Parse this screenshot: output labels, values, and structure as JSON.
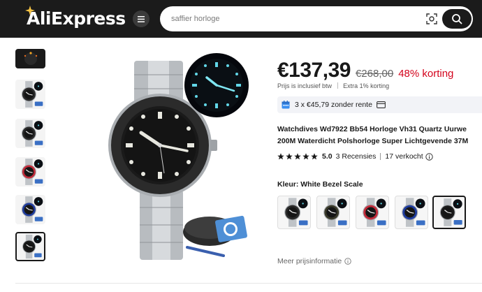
{
  "header": {
    "logo_text": "AliExpress",
    "search_placeholder": "saffier horloge",
    "icons": [
      "menu-icon",
      "camera-search-icon",
      "search-icon"
    ]
  },
  "gallery": {
    "thumbnail_count": 6,
    "active_index": 5
  },
  "product": {
    "price": "€137,39",
    "old_price": "€268,00",
    "discount": "48% korting",
    "vat_text": "Prijs is inclusief btw",
    "extra_discount": "Extra 1% korting",
    "installment_text": "3 x €45,79 zonder rente",
    "title_line1": "Watchdives Wd7922 Bb54 Horloge Vh31 Quartz Uurwe",
    "title_line2": "200M Waterdicht Polshorloge Super Lichtgevende 37M",
    "rating": "5.0",
    "reviews": "3 Recensies",
    "sold": "17 verkocht",
    "stars": 5,
    "color_label": "Kleur: White Bezel Scale",
    "swatch_count": 5,
    "swatch_active_index": 4,
    "swatch_bezels": [
      "#2a2a2a",
      "#3a3a2a",
      "#c22b3a",
      "#1f3c9e",
      "#1b1b1b"
    ],
    "more_info": "Meer prijsinformatie"
  },
  "colors": {
    "header_bg": "#1b1b1b",
    "discount_red": "#d3031c",
    "installment_bg": "#f2f3f7"
  }
}
